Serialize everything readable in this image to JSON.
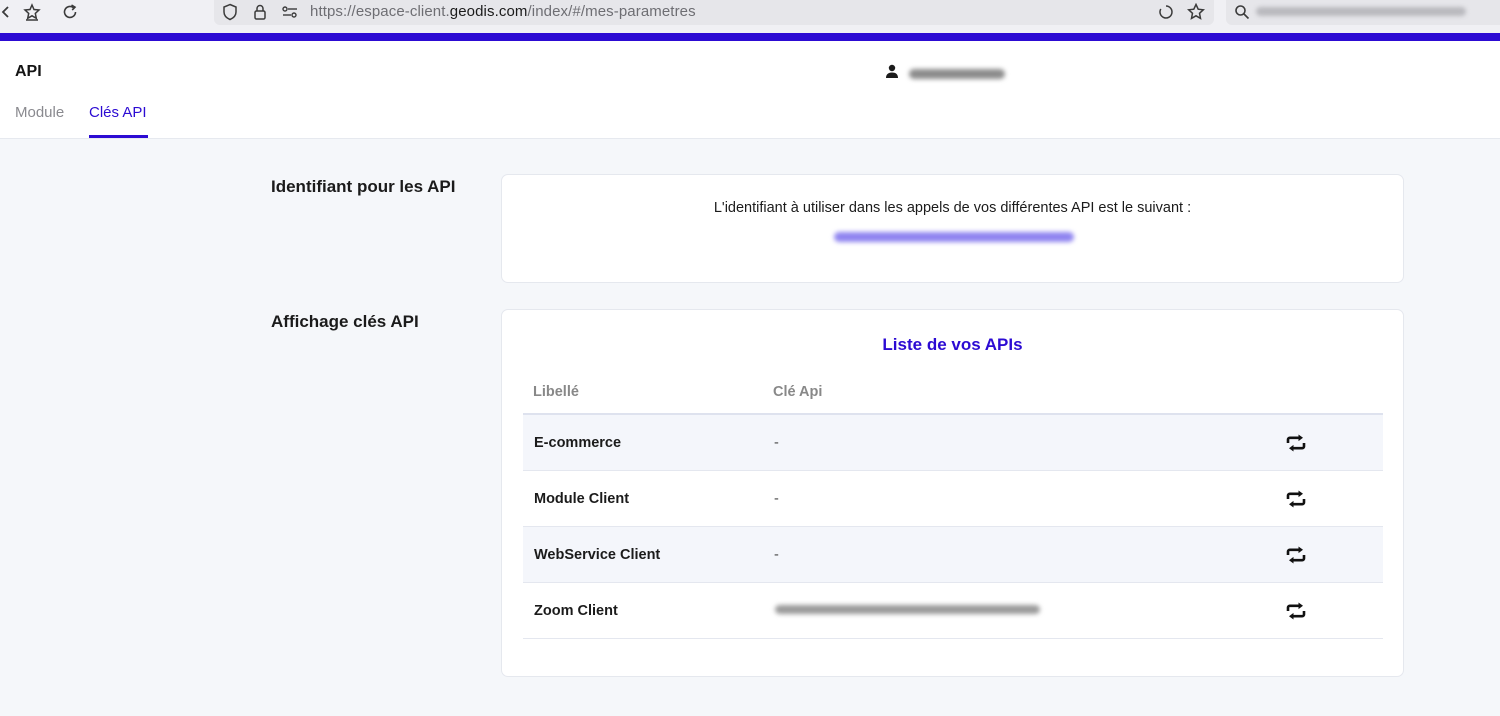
{
  "browser": {
    "url_prefix": "https://espace-client.",
    "url_host": "geodis.com",
    "url_path": "/index/#/mes-parametres"
  },
  "header": {
    "title": "API",
    "tabs": [
      {
        "label": "Module"
      },
      {
        "label": "Clés API"
      }
    ]
  },
  "identifier_section": {
    "label": "Identifiant pour les API",
    "description": "L'identifiant à utiliser dans les appels de vos différentes API est le suivant :"
  },
  "keys_section": {
    "label": "Affichage clés API",
    "list_title": "Liste de vos APIs",
    "columns": [
      "Libellé",
      "Clé Api"
    ],
    "rows": [
      {
        "label": "E-commerce",
        "key": "-"
      },
      {
        "label": "Module Client",
        "key": "-"
      },
      {
        "label": "WebService Client",
        "key": "-"
      },
      {
        "label": "Zoom Client",
        "key": ""
      }
    ]
  },
  "colors": {
    "accent": "#2c0bd3",
    "page_background": "#f5f7fa"
  },
  "icons": {
    "regenerate": "refresh-icon",
    "user": "user-icon"
  }
}
